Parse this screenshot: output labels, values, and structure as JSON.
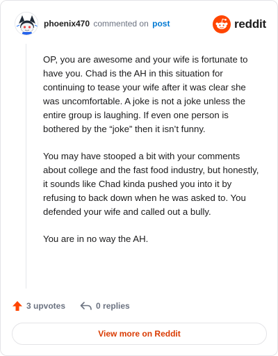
{
  "header": {
    "username": "phoenix470",
    "action_text": "commented on",
    "post_link": "post",
    "brand_word": "reddit",
    "avatar_icon": "snoo-avatar-icon",
    "brand_icon": "reddit-logo-icon"
  },
  "comment": {
    "paragraphs": [
      "OP, you are awesome and your wife is fortunate to have you. Chad is the AH in this situation for continuing to tease your wife after it was clear she was uncomfortable. A joke is not a joke unless the entire group is laughing. If even one person is bothered by the “joke” then it isn’t funny.",
      "You may have stooped a bit with your comments about college and the fast food industry, but honestly, it sounds like Chad kinda pushed you into it by refusing to back down when he was asked to. You defended your wife and called out a bully.",
      "You are in no way the AH."
    ]
  },
  "actions": {
    "upvotes_label": "3 upvotes",
    "replies_label": "0 replies",
    "upvote_icon": "upvote-arrow-icon",
    "reply_icon": "reply-arrow-icon"
  },
  "footer": {
    "view_button_label": "View more on Reddit"
  },
  "colors": {
    "brand_orange": "#ff4500",
    "link_blue": "#0079d3",
    "button_text": "#d93a00",
    "muted_gray": "#6b7280"
  }
}
